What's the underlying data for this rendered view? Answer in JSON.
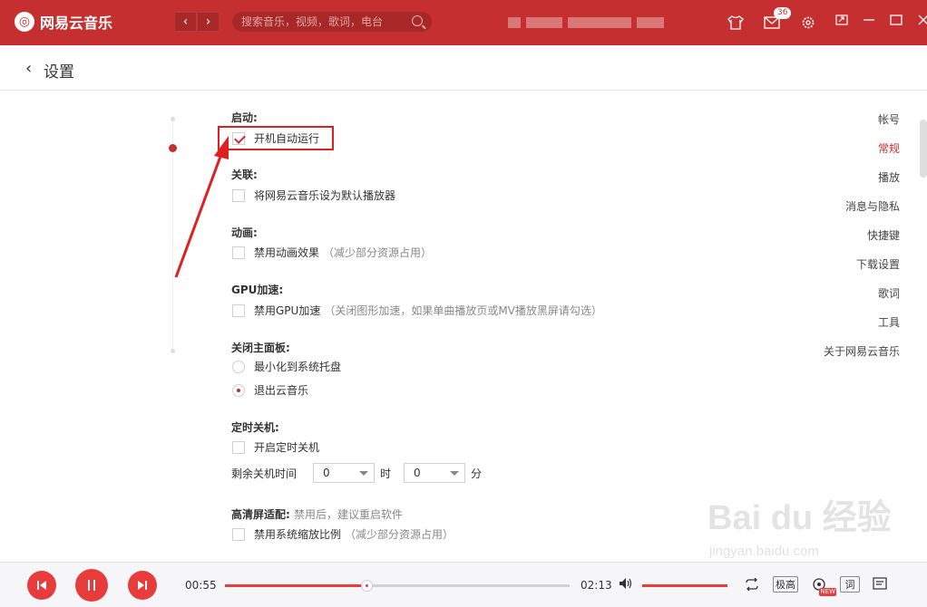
{
  "app": {
    "name": "网易云音乐",
    "logo_glyph": "◎"
  },
  "topbar": {
    "back_glyph": "‹",
    "forward_glyph": "›",
    "search_placeholder": "搜索音乐，视频，歌词，电台",
    "mail_badge": "36",
    "icons": [
      "skin-icon",
      "mail-icon",
      "settings-icon"
    ],
    "window_controls": [
      "mini-mode-icon",
      "minimize-icon",
      "maximize-icon",
      "close-icon"
    ]
  },
  "header": {
    "back_glyph": "‹",
    "title": "设置"
  },
  "sidebar": {
    "items": [
      {
        "label": "帐号",
        "active": false
      },
      {
        "label": "常规",
        "active": true
      },
      {
        "label": "播放",
        "active": false
      },
      {
        "label": "消息与隐私",
        "active": false
      },
      {
        "label": "快捷键",
        "active": false
      },
      {
        "label": "下载设置",
        "active": false
      },
      {
        "label": "歌词",
        "active": false
      },
      {
        "label": "工具",
        "active": false
      },
      {
        "label": "关于网易云音乐",
        "active": false
      }
    ]
  },
  "settings": {
    "startup": {
      "title": "启动:",
      "option": "开机自动运行",
      "checked": true
    },
    "association": {
      "title": "关联:",
      "option": "将网易云音乐设为默认播放器",
      "checked": false
    },
    "animation": {
      "title": "动画:",
      "option": "禁用动画效果",
      "hint": "（减少部分资源占用）",
      "checked": false
    },
    "gpu": {
      "title": "GPU加速:",
      "option": "禁用GPU加速",
      "hint": "（关闭图形加速，如果单曲播放页或MV播放黑屏请勾选）",
      "checked": false
    },
    "close_panel": {
      "title": "关闭主面板:",
      "options": [
        {
          "label": "最小化到系统托盘",
          "checked": false
        },
        {
          "label": "退出云音乐",
          "checked": true
        }
      ]
    },
    "timer": {
      "title": "定时关机:",
      "option": "开启定时关机",
      "checked": false,
      "remaining_label": "剩余关机时间",
      "hours_value": "0",
      "hours_unit": "时",
      "minutes_value": "0",
      "minutes_unit": "分"
    },
    "hidpi": {
      "title": "高清屏适配:",
      "note": "禁用后，建议重启软件",
      "option": "禁用系统缩放比例",
      "hint": "（减少部分资源占用）",
      "checked": false
    }
  },
  "player": {
    "current_time": "00:55",
    "total_time": "02:13",
    "progress": 0.41,
    "volume": 1.0,
    "quality_label": "极高",
    "lyric_label": "词",
    "new_label": "NEW",
    "accent_color": "#e83c3c"
  },
  "watermark": {
    "text": "Bai du 经验",
    "sub": "jingyan.baidu.com"
  },
  "colors": {
    "brand": "#c62f2f",
    "accent": "#e83c3c",
    "highlight": "#e02020"
  }
}
